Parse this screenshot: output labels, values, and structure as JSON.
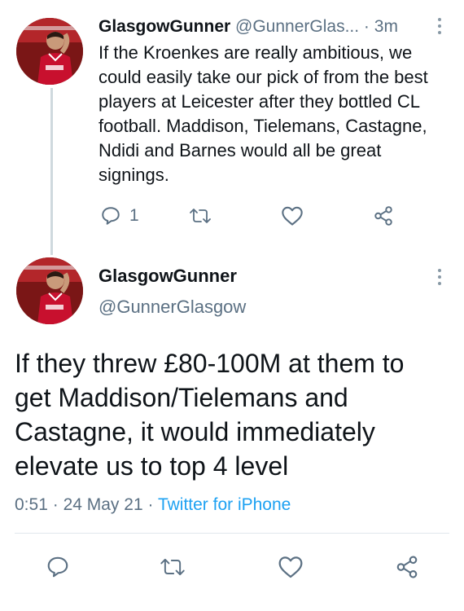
{
  "reply_tweet": {
    "display_name": "GlasgowGunner",
    "handle": "@GunnerGlas...",
    "separator": "·",
    "time_ago": "3m",
    "text": "If the Kroenkes are really ambitious, we could easily take our pick of from the best players at Leicester after they bottled CL football. Maddison, Tielemans, Castagne, Ndidi and Barnes would all be great signings.",
    "reply_count": "1"
  },
  "main_tweet": {
    "display_name": "GlasgowGunner",
    "handle": "@GunnerGlasgow",
    "text": "If they threw £80-100M at them to get Maddison/Tielemans and Castagne, it would immediately elevate us to top 4 level",
    "time": "0:51",
    "separator": "·",
    "date": "24 May 21",
    "separator2": "·",
    "source": "Twitter for iPhone"
  },
  "colors": {
    "link": "#1da1f2",
    "muted": "#5b7083",
    "jersey": "#c8102e"
  },
  "icons": [
    "reply-icon",
    "retweet-icon",
    "like-icon",
    "share-icon",
    "more-options-icon"
  ]
}
